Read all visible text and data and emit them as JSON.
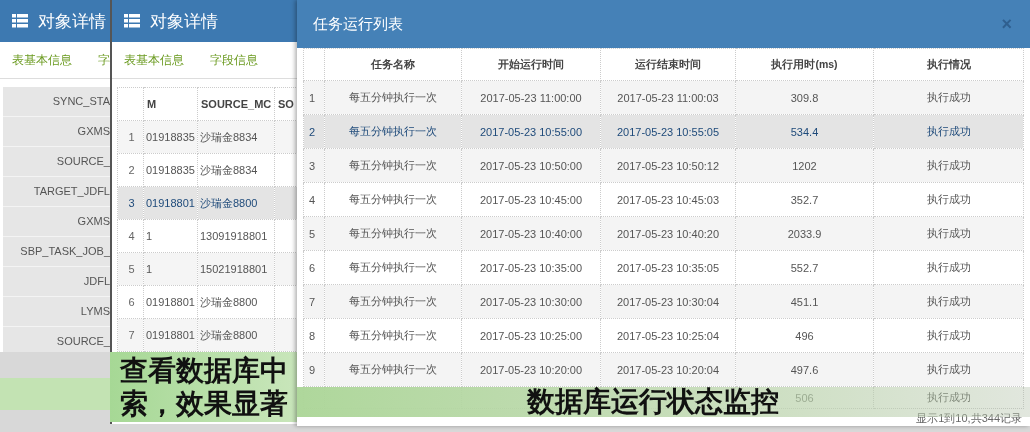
{
  "back_panel": {
    "title": "对象详情",
    "tabs": [
      {
        "label": "表基本信息",
        "selected": false
      },
      {
        "label": "字",
        "selected": false
      }
    ],
    "fields": [
      "SYNC_STA",
      "GXMS",
      "SOURCE_",
      "TARGET_JDFL",
      "GXMS",
      "SBP_TASK_JOB_",
      "JDFL",
      "LYMS",
      "SOURCE_"
    ]
  },
  "middle_panel": {
    "title": "对象详情",
    "tabs": [
      {
        "label": "表基本信息",
        "selected": false
      },
      {
        "label": "字段信息",
        "selected": false
      }
    ],
    "columns": [
      "M",
      "SOURCE_MC",
      "SO"
    ],
    "rows": [
      {
        "num": "1",
        "code": "01918835",
        "name": "沙瑞金8834",
        "selected": false
      },
      {
        "num": "2",
        "code": "01918835",
        "name": "沙瑞金8834",
        "selected": false
      },
      {
        "num": "3",
        "code": "01918801",
        "name": "沙瑞金8800",
        "selected": true
      },
      {
        "num": "4",
        "code": "1",
        "name": "13091918801",
        "selected": false
      },
      {
        "num": "5",
        "code": "1",
        "name": "15021918801",
        "selected": false
      },
      {
        "num": "6",
        "code": "01918801",
        "name": "沙瑞金8800",
        "selected": false
      },
      {
        "num": "7",
        "code": "01918801",
        "name": "沙瑞金8800",
        "selected": false
      }
    ],
    "caption": [
      "查看数据库中",
      "索，效果显著"
    ]
  },
  "task_dialog": {
    "title": "任务运行列表",
    "close": "×",
    "columns": [
      "任务名称",
      "开始运行时间",
      "运行结束时间",
      "执行用时(ms)",
      "执行情况"
    ],
    "rows": [
      {
        "num": "1",
        "name": "每五分钟执行一次",
        "start": "2017-05-23 11:00:00",
        "end": "2017-05-23 11:00:03",
        "duration": "309.8",
        "status": "执行成功",
        "selected": false
      },
      {
        "num": "2",
        "name": "每五分钟执行一次",
        "start": "2017-05-23 10:55:00",
        "end": "2017-05-23 10:55:05",
        "duration": "534.4",
        "status": "执行成功",
        "selected": true
      },
      {
        "num": "3",
        "name": "每五分钟执行一次",
        "start": "2017-05-23 10:50:00",
        "end": "2017-05-23 10:50:12",
        "duration": "1202",
        "status": "执行成功",
        "selected": false
      },
      {
        "num": "4",
        "name": "每五分钟执行一次",
        "start": "2017-05-23 10:45:00",
        "end": "2017-05-23 10:45:03",
        "duration": "352.7",
        "status": "执行成功",
        "selected": false
      },
      {
        "num": "5",
        "name": "每五分钟执行一次",
        "start": "2017-05-23 10:40:00",
        "end": "2017-05-23 10:40:20",
        "duration": "2033.9",
        "status": "执行成功",
        "selected": false
      },
      {
        "num": "6",
        "name": "每五分钟执行一次",
        "start": "2017-05-23 10:35:00",
        "end": "2017-05-23 10:35:05",
        "duration": "552.7",
        "status": "执行成功",
        "selected": false
      },
      {
        "num": "7",
        "name": "每五分钟执行一次",
        "start": "2017-05-23 10:30:00",
        "end": "2017-05-23 10:30:04",
        "duration": "451.1",
        "status": "执行成功",
        "selected": false
      },
      {
        "num": "8",
        "name": "每五分钟执行一次",
        "start": "2017-05-23 10:25:00",
        "end": "2017-05-23 10:25:04",
        "duration": "496",
        "status": "执行成功",
        "selected": false
      },
      {
        "num": "9",
        "name": "每五分钟执行一次",
        "start": "2017-05-23 10:20:00",
        "end": "2017-05-23 10:20:04",
        "duration": "497.6",
        "status": "执行成功",
        "selected": false
      },
      {
        "duration": "506",
        "status": "执行成功",
        "selected": false
      }
    ],
    "footer": "显示1到10,共344记录",
    "caption": "数据库运行状态监控"
  }
}
